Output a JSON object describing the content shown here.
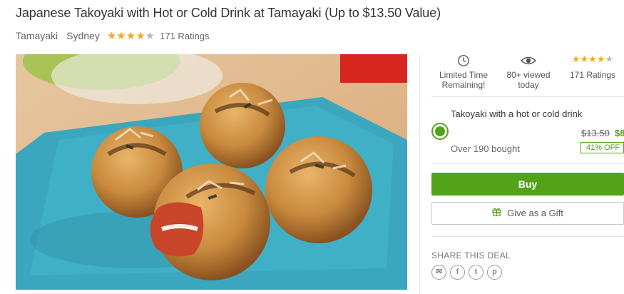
{
  "deal": {
    "title": "Japanese Takoyaki with Hot or Cold Drink at Tamayaki (Up to $13.50 Value)",
    "merchant": "Tamayaki",
    "location": "Sydney",
    "rating": {
      "filled_stars": 4,
      "total_stars": 5,
      "ratings_text": "171 Ratings"
    },
    "image_alt": "Takoyaki balls with bonito flakes on a blue plate"
  },
  "stats": [
    {
      "icon": "clock-icon",
      "line1": "Limited Time",
      "line2": "Remaining!"
    },
    {
      "icon": "eye-icon",
      "line1": "80+ viewed",
      "line2": "today"
    },
    {
      "icon": "stars-icon",
      "line1": "171 Ratings",
      "line2": ""
    }
  ],
  "option": {
    "title": "Takoyaki with a hot or cold drink",
    "original_price": "$13.50",
    "price": "$8",
    "bought": "Over 190 bought",
    "discount": "41% OFF"
  },
  "buttons": {
    "buy": "Buy",
    "gift": "Give as a Gift"
  },
  "share": {
    "label": "SHARE THIS DEAL",
    "icons": [
      "email-icon",
      "facebook-icon",
      "twitter-icon",
      "pinterest-icon"
    ],
    "glyphs": [
      "✉",
      "f",
      "t",
      "p"
    ]
  },
  "colors": {
    "accent": "#53a318",
    "star": "#f5a623",
    "star_empty": "#bbbbbb"
  }
}
